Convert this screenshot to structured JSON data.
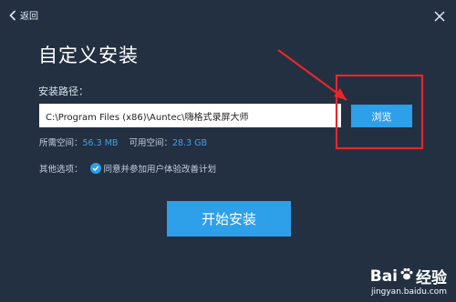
{
  "topbar": {
    "back_label": "返回"
  },
  "title": "自定义安装",
  "path": {
    "label": "安装路径：",
    "value": "C:\\Program Files (x86)\\Auntec\\嗨格式录屏大师",
    "browse_label": "浏览"
  },
  "space": {
    "required_label": "所需空间：",
    "required_value": "56.3 MB",
    "available_label": "可用空间：",
    "available_value": "28.3 GB"
  },
  "options": {
    "label": "其他选项：",
    "agree_label": "同意并参加用户体验改善计划",
    "agree_checked": true
  },
  "install_label": "开始安装",
  "watermark": {
    "brand_left": "Bai",
    "brand_right": "经验",
    "url": "jingyan.baidu.com"
  },
  "colors": {
    "background": "#233042",
    "accent": "#2e9fe9",
    "annotation": "#e8262b"
  }
}
